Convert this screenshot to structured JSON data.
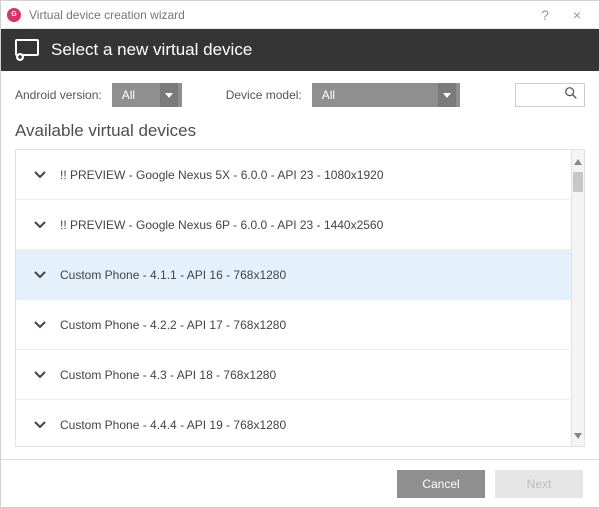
{
  "titlebar": {
    "title": "Virtual device creation wizard",
    "help": "?",
    "close": "×"
  },
  "banner": {
    "title": "Select a new virtual device"
  },
  "filters": {
    "android_label": "Android version:",
    "android_selected": "All",
    "model_label": "Device model:",
    "model_selected": "All",
    "search_value": ""
  },
  "section": {
    "title": "Available virtual devices"
  },
  "devices": [
    {
      "label": "!! PREVIEW - Google Nexus 5X - 6.0.0 - API 23 - 1080x1920",
      "selected": false
    },
    {
      "label": "!! PREVIEW - Google Nexus 6P - 6.0.0 - API 23 - 1440x2560",
      "selected": false
    },
    {
      "label": "Custom Phone - 4.1.1 - API 16 - 768x1280",
      "selected": true
    },
    {
      "label": "Custom Phone - 4.2.2 - API 17 - 768x1280",
      "selected": false
    },
    {
      "label": "Custom Phone - 4.3 - API 18 - 768x1280",
      "selected": false
    },
    {
      "label": "Custom Phone - 4.4.4 - API 19 - 768x1280",
      "selected": false
    }
  ],
  "footer": {
    "cancel": "Cancel",
    "next": "Next"
  }
}
